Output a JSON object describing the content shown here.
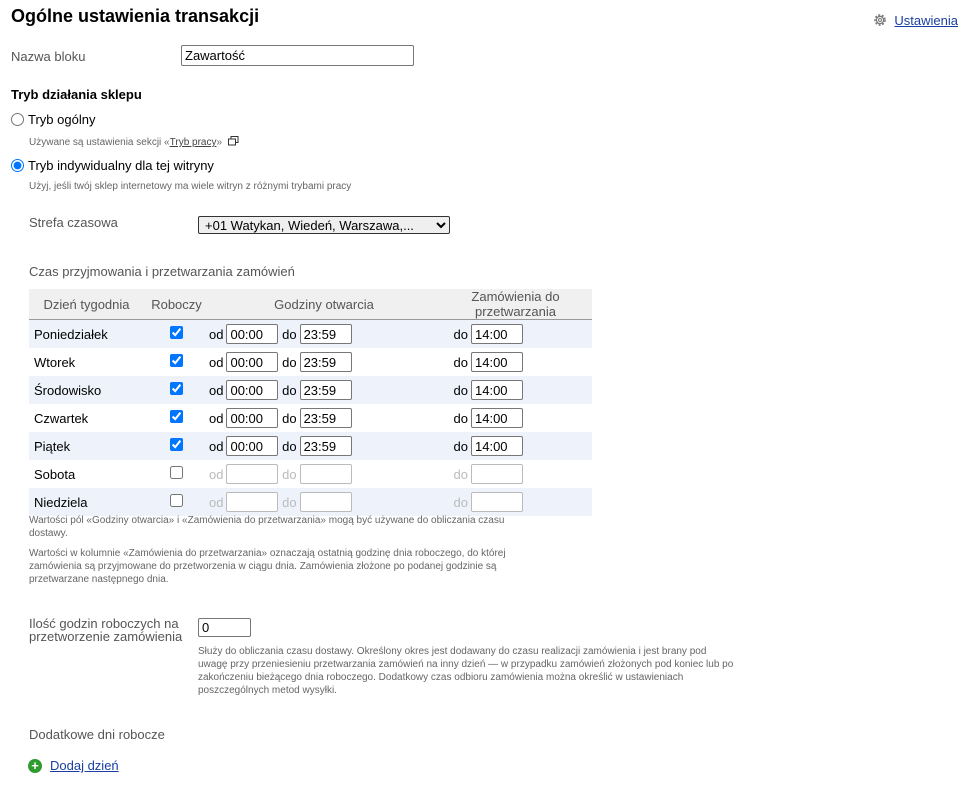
{
  "header": {
    "title": "Ogólne ustawienia transakcji",
    "settings_label": "Ustawienia"
  },
  "block_name": {
    "label": "Nazwa bloku",
    "value": "Zawartość"
  },
  "mode": {
    "title": "Tryb działania sklepu",
    "general": {
      "label": "Tryb ogólny",
      "hint_prefix": "Używane są ustawienia sekcji «",
      "hint_link": "Tryb pracy",
      "hint_suffix": "»",
      "selected": false
    },
    "individual": {
      "label": "Tryb indywidualny dla tej witryny",
      "hint": "Użyj, jeśli twój sklep internetowy ma wiele witryn z różnymi trybami pracy",
      "selected": true
    }
  },
  "timezone": {
    "label": "Strefa czasowa",
    "value": "+01 Watykan, Wiedeń, Warszawa,..."
  },
  "schedule": {
    "title": "Czas przyjmowania i przetwarzania zamówień",
    "headers": [
      "Dzień tygodnia",
      "Roboczy",
      "Godziny otwarcia",
      "Zamówienia do przetwarzania"
    ],
    "from_label": "od",
    "to_label": "do",
    "rows": [
      {
        "day": "Poniedziałek",
        "working": true,
        "from": "00:00",
        "to": "23:59",
        "orders_to": "14:00"
      },
      {
        "day": "Wtorek",
        "working": true,
        "from": "00:00",
        "to": "23:59",
        "orders_to": "14:00"
      },
      {
        "day": "Środowisko",
        "working": true,
        "from": "00:00",
        "to": "23:59",
        "orders_to": "14:00"
      },
      {
        "day": "Czwartek",
        "working": true,
        "from": "00:00",
        "to": "23:59",
        "orders_to": "14:00"
      },
      {
        "day": "Piątek",
        "working": true,
        "from": "00:00",
        "to": "23:59",
        "orders_to": "14:00"
      },
      {
        "day": "Sobota",
        "working": false,
        "from": "",
        "to": "",
        "orders_to": ""
      },
      {
        "day": "Niedziela",
        "working": false,
        "from": "",
        "to": "",
        "orders_to": ""
      }
    ],
    "note1": "Wartości pól «Godziny otwarcia» i «Zamówienia do przetwarzania» mogą być używane do obliczania czasu dostawy.",
    "note2": "Wartości w kolumnie «Zamówienia do przetwarzania» oznaczają ostatnią godzinę dnia roboczego, do której zamówienia są przyjmowane do przetworzenia w ciągu dnia. Zamówienia złożone po podanej godzinie są przetwarzane następnego dnia."
  },
  "processing_hours": {
    "label": "Ilość godzin roboczych na przetworzenie zamówienia",
    "value": "0",
    "hint": "Służy do obliczania czasu dostawy. Określony okres jest dodawany do czasu realizacji zamówienia i jest brany pod uwagę przy przeniesieniu przetwarzania zamówień na inny dzień — w przypadku zamówień złożonych pod koniec lub po zakończeniu bieżącego dnia roboczego. Dodatkowy czas odbioru zamówienia można określić w ustawieniach poszczególnych metod wysyłki."
  },
  "extra_days": {
    "title": "Dodatkowe dni robocze",
    "add_label": "Dodaj dzień"
  }
}
